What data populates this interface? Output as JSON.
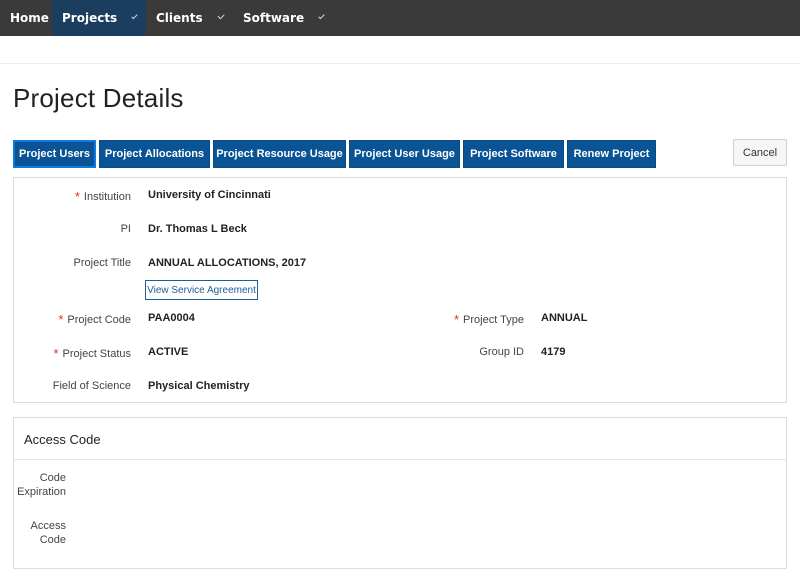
{
  "nav": {
    "home": "Home",
    "projects": "Projects",
    "clients": "Clients",
    "software": "Software"
  },
  "page": {
    "title": "Project Details"
  },
  "tabs": [
    "Project Users",
    "Project Allocations",
    "Project Resource Usage",
    "Project User Usage",
    "Project Software",
    "Renew Project"
  ],
  "cancel_label": "Cancel",
  "details": {
    "institution_label": "Institution",
    "institution_value": "University of Cincinnati",
    "pi_label": "PI",
    "pi_value": "Dr. Thomas L Beck",
    "project_title_label": "Project Title",
    "project_title_value": "ANNUAL ALLOCATIONS, 2017",
    "service_agreement_link": "View Service Agreement",
    "project_code_label": "Project Code",
    "project_code_value": "PAA0004",
    "project_type_label": "Project Type",
    "project_type_value": "ANNUAL",
    "project_status_label": "Project Status",
    "project_status_value": "ACTIVE",
    "group_id_label": "Group ID",
    "group_id_value": "4179",
    "field_of_science_label": "Field of Science",
    "field_of_science_value": "Physical Chemistry",
    "required_marker": "*"
  },
  "access": {
    "title": "Access Code",
    "code_expiration_line1": "Code",
    "code_expiration_line2": "Expiration",
    "access_code_line1": "Access",
    "access_code_line2": "Code"
  },
  "colors": {
    "nav_bg": "#3a3a3a",
    "nav_active": "#1b3e5e",
    "button_blue": "#0a5496",
    "required_red": "#e0302a"
  }
}
